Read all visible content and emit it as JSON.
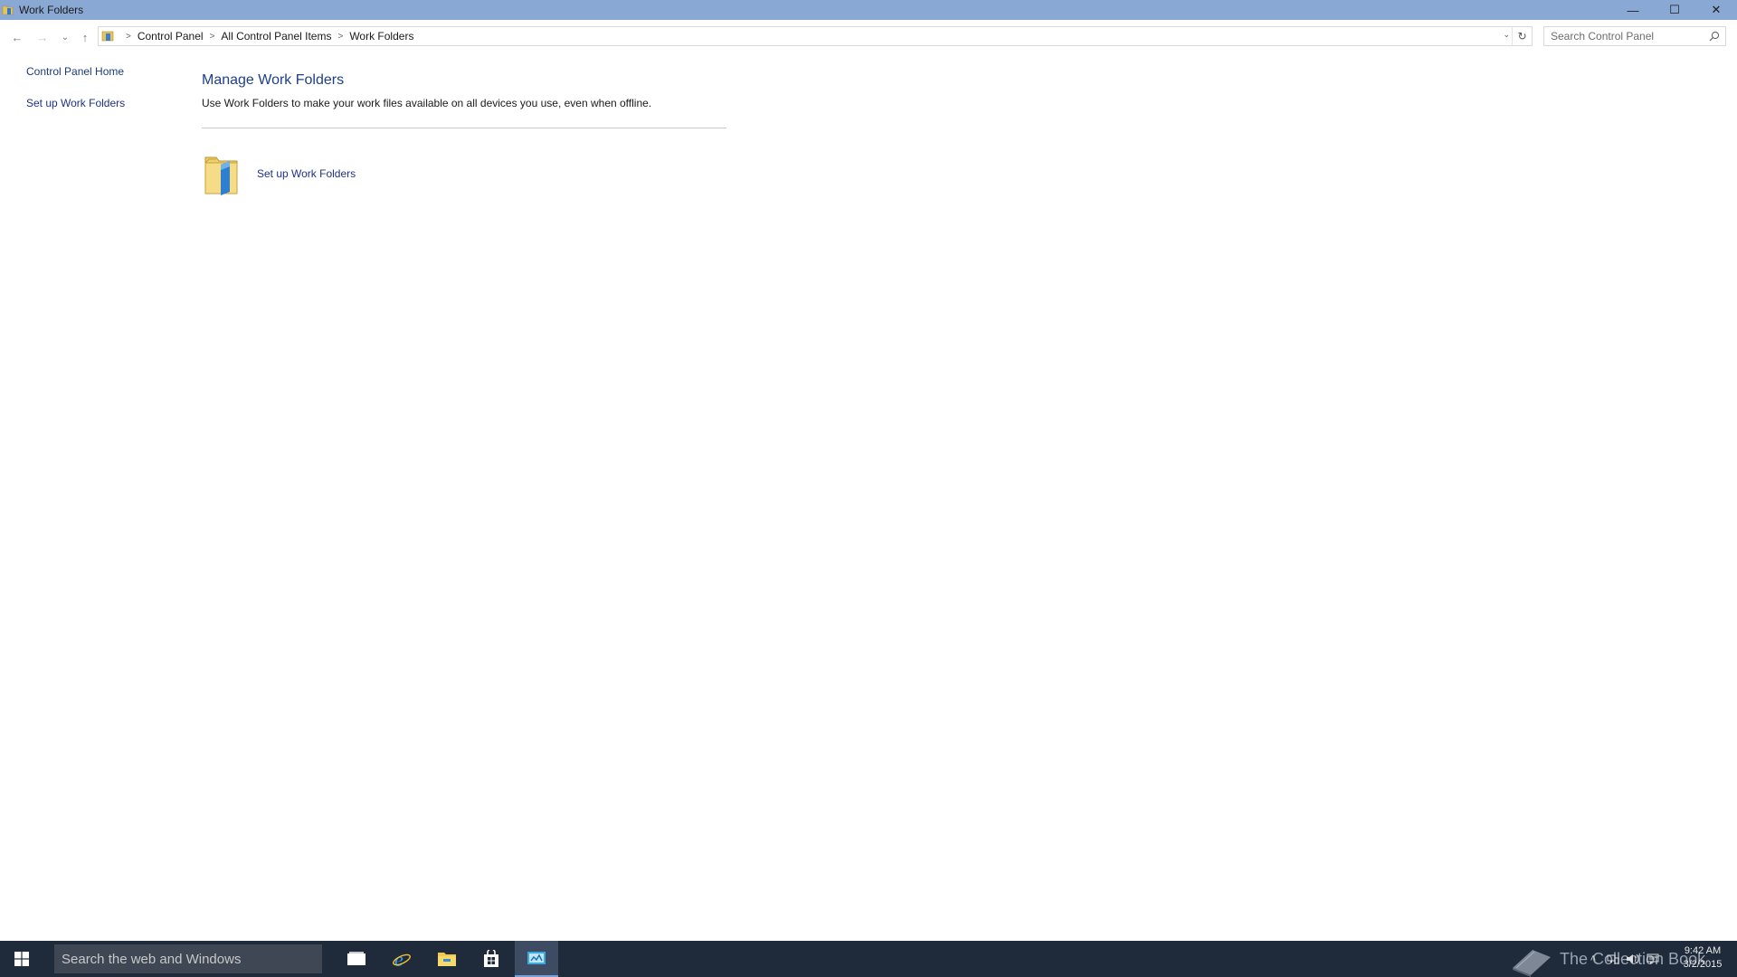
{
  "window": {
    "title": "Work Folders",
    "controls": {
      "minimize": "—",
      "maximize": "☐",
      "close": "✕"
    }
  },
  "nav": {
    "back": "←",
    "forward": "→",
    "recent": "⌄",
    "up": "↑",
    "breadcrumbs": [
      "Control Panel",
      "All Control Panel Items",
      "Work Folders"
    ],
    "separator": ">",
    "dropdown": "⌄",
    "refresh": "↻",
    "search_placeholder": "Search Control Panel"
  },
  "sidebar": {
    "items": [
      {
        "label": "Control Panel Home"
      },
      {
        "label": "Set up Work Folders"
      }
    ]
  },
  "main": {
    "title": "Manage Work Folders",
    "description": "Use Work Folders to make your work files available on all devices you use, even when offline.",
    "task_label": "Set up Work Folders"
  },
  "taskbar": {
    "search_placeholder": "Search the web and Windows",
    "watermark": "The Collection Book",
    "time": "9:42 AM",
    "date": "3/2/2015",
    "apps": [
      "task-view-icon",
      "internet-explorer-icon",
      "file-explorer-icon",
      "store-icon",
      "control-panel-icon"
    ],
    "active_app": "control-panel-icon"
  },
  "colors": {
    "titlebar": "#8aa8d4",
    "link": "#1e3287",
    "heading": "#1e3f8c",
    "taskbar": "#1f2a3a"
  }
}
